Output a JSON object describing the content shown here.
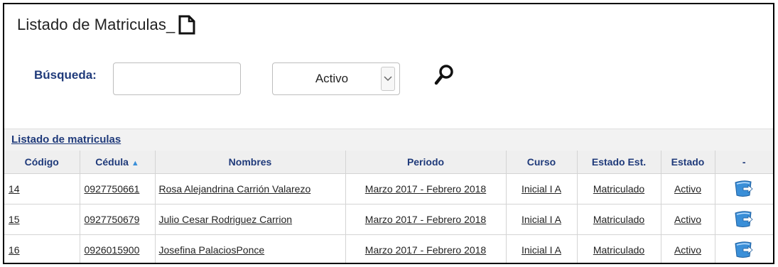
{
  "page": {
    "title": "Listado de Matriculas_",
    "new_icon": "new-document-icon"
  },
  "search": {
    "label": "Búsqueda:",
    "value": "",
    "placeholder": "",
    "status_value": "Activo",
    "search_icon": "magnifier-icon"
  },
  "list": {
    "title": "Listado de matriculas",
    "columns": {
      "codigo": "Código",
      "cedula": "Cédula",
      "cedula_sort": "▲",
      "nombres": "Nombres",
      "periodo": "Periodo",
      "curso": "Curso",
      "estado_est": "Estado Est.",
      "estado": "Estado",
      "accion": "-"
    },
    "rows": [
      {
        "codigo": "14",
        "cedula": "0927750661",
        "nombres": "Rosa Alejandrina Carrión Valarezo",
        "periodo": "Marzo 2017  - Febrero 2018",
        "curso": "Inicial I A",
        "estado_est": "Matriculado",
        "estado": "Activo",
        "icon": "edit-document-icon"
      },
      {
        "codigo": "15",
        "cedula": "0927750679",
        "nombres": "Julio Cesar Rodriguez Carrion",
        "periodo": "Marzo 2017  - Febrero 2018",
        "curso": "Inicial I A",
        "estado_est": "Matriculado",
        "estado": "Activo",
        "icon": "edit-document-icon"
      },
      {
        "codigo": "16",
        "cedula": "0926015900",
        "nombres": "Josefina PalaciosPonce",
        "periodo": "Marzo 2017  - Febrero 2018",
        "curso": "Inicial I A",
        "estado_est": "Matriculado",
        "estado": "Activo",
        "icon": "edit-document-icon"
      }
    ]
  },
  "colors": {
    "accent": "#1f3a7a",
    "header_bg": "#efefef",
    "icon_blue": "#3a8fd8"
  }
}
